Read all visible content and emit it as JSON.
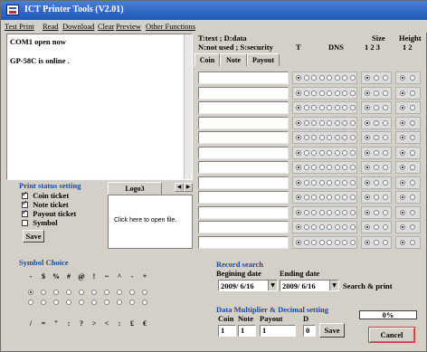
{
  "window": {
    "title": "ICT Printer Tools (V2.01)"
  },
  "menu": [
    "Test Print",
    "Read",
    "Download",
    "Clear",
    "Preview",
    "Other Functions"
  ],
  "status": {
    "line1": "COM1 open now",
    "line2": "GP-58C is online ."
  },
  "print_status": {
    "title": "Print status setting",
    "items": [
      {
        "label": "Coin ticket",
        "checked": true
      },
      {
        "label": "Note ticket",
        "checked": true
      },
      {
        "label": "Payout ticket",
        "checked": true
      },
      {
        "label": "Symbol",
        "checked": false
      }
    ],
    "save_label": "Save"
  },
  "logo": {
    "tab_label": "Logo3",
    "open_file_text": "Click here to open file."
  },
  "table": {
    "header_line1": "T:text ; D:data",
    "header_line2": "N:not used ; S:security",
    "tabs": [
      "Coin",
      "Note",
      "Payout"
    ],
    "col_labels": [
      "T",
      "DNS"
    ],
    "size_label": "Size",
    "size_nums": "1 2 3",
    "height_label": "Height",
    "height_nums": "1 2",
    "row_count": 12
  },
  "symbol_choice": {
    "title": "Symbol Choice",
    "row1": [
      "-",
      "$",
      "%",
      "#",
      "@",
      "!",
      "~",
      "^",
      "-",
      "+"
    ],
    "row3": [
      "/",
      "=",
      "\"",
      ":",
      "?",
      ">",
      "<",
      ":",
      "£",
      "€"
    ]
  },
  "record_search": {
    "title": "Record search",
    "begin_label": "Begining date",
    "end_label": "Ending date",
    "begin_value": "2009/ 6/16",
    "end_value": "2009/ 6/16",
    "search_button": "Search & print"
  },
  "data_multiplier": {
    "title": "Data Multiplier  &  Decimal setting",
    "labels": [
      "Coin",
      "Note",
      "Payout",
      "D"
    ],
    "values": [
      "1",
      "1",
      "1",
      "0"
    ],
    "save_label": "Save"
  },
  "progress": {
    "text": "0%",
    "value": 0
  },
  "cancel_label": "Cancel",
  "colors": {
    "accent": "#1a4aa0",
    "cancel_border": "#d04040",
    "title_bar": "#1f57b8"
  }
}
